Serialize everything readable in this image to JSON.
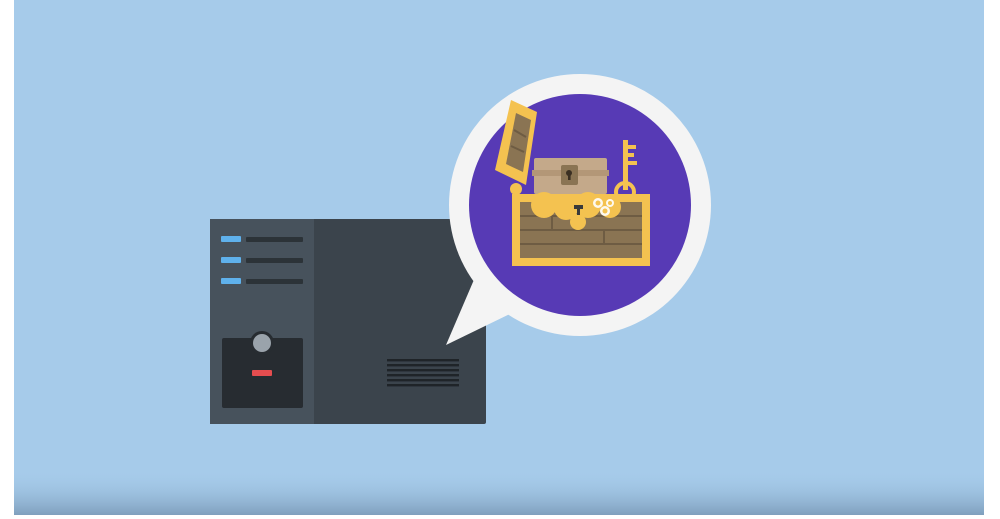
{
  "scene": {
    "background_color": "#a6cbea",
    "bottom_fade_color": "#7f9fbd",
    "server": {
      "body_color": "#3b444c",
      "panel_color": "#47525c",
      "indicator_color": "#5fb1ec",
      "slot_color": "#2c3338",
      "button_color": "#9aa3ab",
      "alert_color": "#e54d4f"
    },
    "bubble": {
      "ring_color": "#f4f4f4",
      "circle_color": "#573ab5",
      "icon": "treasure-chest-with-key-icon"
    },
    "treasure": {
      "gold_color": "#f4c250",
      "wood_color": "#8a7453",
      "inner_color": "#c4a98a",
      "key_color": "#f4c250"
    }
  }
}
